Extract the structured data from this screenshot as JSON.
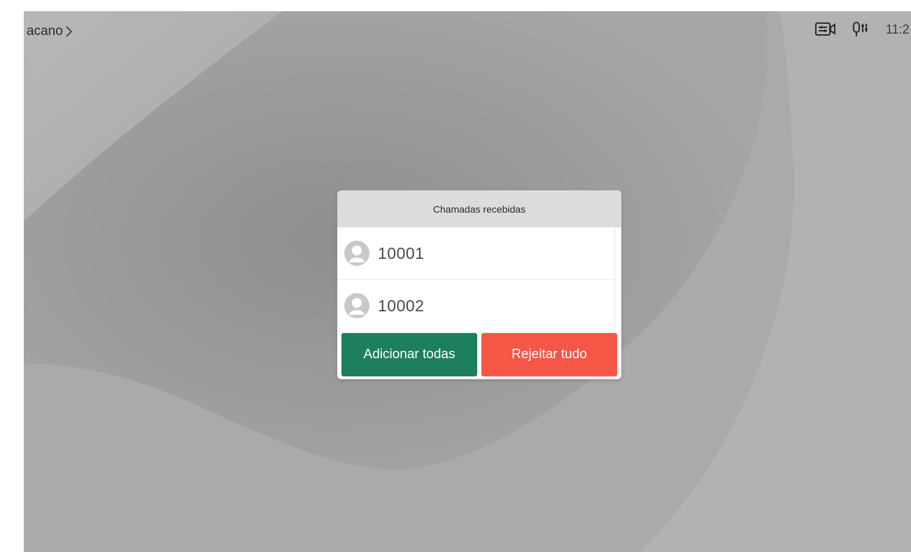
{
  "topbar": {
    "location": "acano",
    "clock": "11:2",
    "icons": [
      "chevron-right-icon",
      "video-settings-icon",
      "mic-settings-icon"
    ]
  },
  "dialog": {
    "title": "Chamadas recebidas",
    "calls": [
      {
        "label": "10001"
      },
      {
        "label": "10002"
      }
    ],
    "accept_label": "Adicionar todas",
    "reject_label": "Rejeitar tudo"
  },
  "colors": {
    "accept": "#1d7f5e",
    "reject": "#f65646",
    "header": "#dcdcdc",
    "background": "#a9a9a9"
  }
}
